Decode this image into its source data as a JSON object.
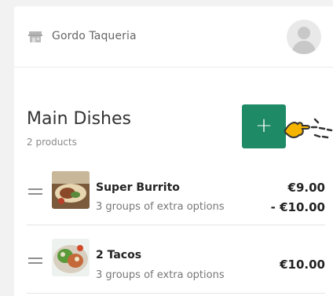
{
  "header": {
    "store_name": "Gordo Taqueria",
    "store_icon": "store-icon",
    "avatar_icon": "user-avatar-icon"
  },
  "section": {
    "title": "Main Dishes",
    "count": "2 products",
    "add_label": "+",
    "accent_color": "#1e8a66"
  },
  "products": [
    {
      "name": "Super Burrito",
      "subtitle": "3 groups of extra options",
      "price_line1": "€9.00",
      "price_line2": "- €10.00"
    },
    {
      "name": "2 Tacos",
      "subtitle": "3 groups of extra options",
      "price": "€10.00"
    }
  ]
}
